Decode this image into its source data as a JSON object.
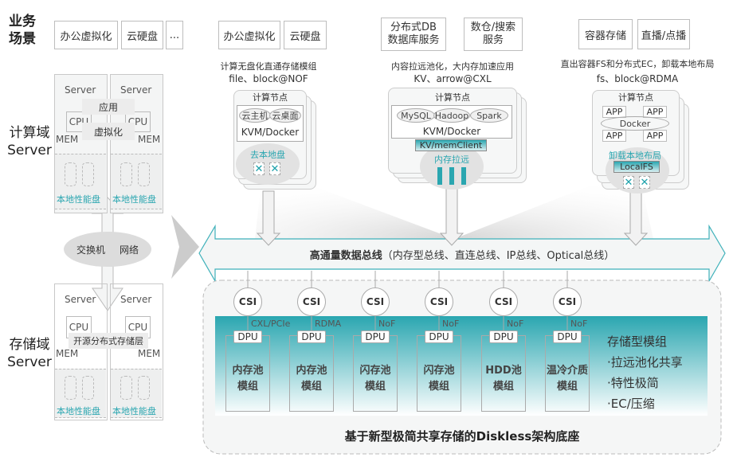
{
  "scenario_label": "业务\n场景",
  "top_row": {
    "left": [
      "办公虚拟化",
      "云硬盘",
      "..."
    ],
    "group1": [
      "办公虚拟化",
      "云硬盘"
    ],
    "group2": [
      "分布式DB\n数据库服务",
      "数仓/搜索\n服务"
    ],
    "group3": [
      "容器存储",
      "直播/点播"
    ]
  },
  "compute_domain": {
    "label": "计算域\nServer",
    "server": "Server",
    "app": "应用",
    "virt": "虚拟化",
    "cpu": "CPU",
    "mem": "MEM",
    "disk": "本地性能盘"
  },
  "network": {
    "switch": "交换机",
    "net": "网络"
  },
  "storage_domain": {
    "label": "存储域\nServer",
    "server": "Server",
    "cpu": "CPU",
    "mem": "MEM",
    "layer": "开源分布式存储层",
    "disk": "本地性能盘"
  },
  "nodes": [
    {
      "desc": "计算无盘化直通存储模组",
      "proto": "file、block@NOF",
      "title": "计算节点",
      "apps": [
        "云主机",
        "云桌面"
      ],
      "runtime": "KVM/Docker",
      "bottom": "去本地盘"
    },
    {
      "desc": "内容拉远池化，大内存加速应用",
      "proto": "KV、arrow@CXL",
      "title": "计算节点",
      "apps": [
        "MySQL",
        "Hadoop",
        "Spark"
      ],
      "runtime": "KVM/Docker",
      "client": "KV/memClient",
      "bottom": "内存拉远"
    },
    {
      "desc": "直出容器FS和分布式EC，卸载本地布局",
      "proto": "fs、block@RDMA",
      "title": "计算节点",
      "apps": [
        "APP",
        "APP",
        "APP",
        "APP"
      ],
      "runtime": "Docker",
      "bottom": "卸载本地布局",
      "fs": "LocalFS"
    }
  ],
  "bus": {
    "title": "高通量数据总线",
    "detail": "（内存型总线、直连总线、IP总线、Optical总线）"
  },
  "storage_modules": [
    {
      "csi": "CSI",
      "proto": "CXL/PCIe",
      "dpu": "DPU",
      "name": "内存池\n模组"
    },
    {
      "csi": "CSI",
      "proto": "RDMA",
      "dpu": "DPU",
      "name": "内存池\n模组"
    },
    {
      "csi": "CSI",
      "proto": "NoF",
      "dpu": "DPU",
      "name": "闪存池\n模组"
    },
    {
      "csi": "CSI",
      "proto": "NoF",
      "dpu": "DPU",
      "name": "闪存池\n模组"
    },
    {
      "csi": "CSI",
      "proto": "NoF",
      "dpu": "DPU",
      "name": "HDD池\n模组"
    },
    {
      "csi": "CSI",
      "proto": "NoF",
      "dpu": "DPU",
      "name": "温冷介质\n模组"
    }
  ],
  "module_features": {
    "title": "存储型模组",
    "items": [
      "·拉远池化共享",
      "·特性极简",
      "·EC/压缩"
    ]
  },
  "base_caption": "基于新型极简共享存储的Diskless架构底座",
  "colors": {
    "teal": "#2aa6b0",
    "gray": "#e6e6e6"
  }
}
